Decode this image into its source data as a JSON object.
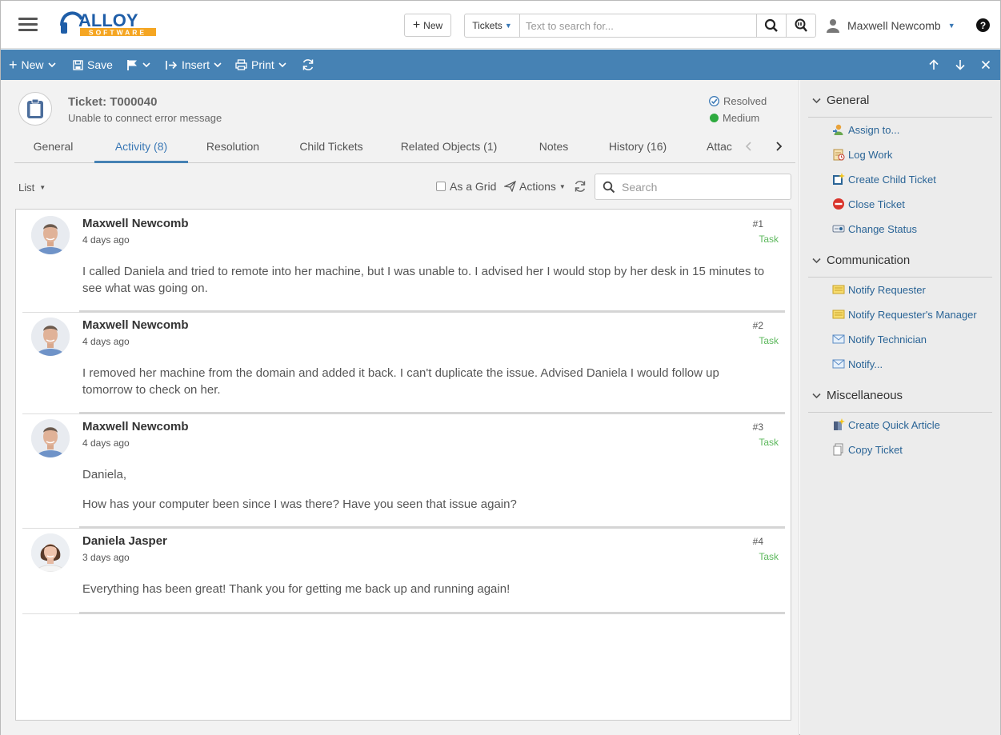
{
  "header": {
    "logo_text": "ALLOY",
    "logo_sub": "SOFTWARE",
    "new_button": "New",
    "search_category": "Tickets",
    "search_placeholder": "Text to search for...",
    "user_name": "Maxwell Newcomb",
    "help": "?"
  },
  "toolbar": {
    "new": "New",
    "save": "Save",
    "insert": "Insert",
    "print": "Print"
  },
  "ticket": {
    "title": "Ticket: T000040",
    "subtitle": "Unable to connect error message",
    "status": "Resolved",
    "priority": "Medium"
  },
  "tabs": [
    "General",
    "Activity (8)",
    "Resolution",
    "Child Tickets",
    "Related Objects (1)",
    "Notes",
    "History (16)",
    "Attac"
  ],
  "filter": {
    "view": "List",
    "as_grid": "As a Grid",
    "actions": "Actions",
    "search_placeholder": "Search"
  },
  "entries": [
    {
      "author": "Maxwell Newcomb",
      "date": "4 days ago",
      "num": "#1",
      "type": "Task",
      "body": [
        "I called Daniela and tried to remote into her machine, but I was unable to. I advised her I would stop by her desk in 15 minutes to see what was going on."
      ]
    },
    {
      "author": "Maxwell Newcomb",
      "date": "4 days ago",
      "num": "#2",
      "type": "Task",
      "body": [
        "I removed her machine from the domain and added it back. I can't duplicate the issue. Advised Daniela I would follow up tomorrow to check on her."
      ]
    },
    {
      "author": "Maxwell Newcomb",
      "date": "4 days ago",
      "num": "#3",
      "type": "Task",
      "body": [
        "Daniela,",
        "How has your computer been since I was there? Have you seen that issue again?"
      ]
    },
    {
      "author": "Daniela Jasper",
      "date": "3 days ago",
      "num": "#4",
      "type": "Task",
      "body": [
        "Everything has been great! Thank you for getting me back up and running again!"
      ]
    }
  ],
  "sidebar": {
    "groups": [
      {
        "title": "General",
        "items": [
          "Assign to...",
          "Log Work",
          "Create Child Ticket",
          "Close Ticket",
          "Change Status"
        ]
      },
      {
        "title": "Communication",
        "items": [
          "Notify Requester",
          "Notify Requester's Manager",
          "Notify Technician",
          "Notify..."
        ]
      },
      {
        "title": "Miscellaneous",
        "items": [
          "Create Quick Article",
          "Copy Ticket"
        ]
      }
    ]
  },
  "colors": {
    "accent": "#4682b4",
    "link": "#2a6496",
    "task": "#5cb85c",
    "logo_orange": "#f5a623",
    "logo_blue": "#1f5ea8"
  }
}
